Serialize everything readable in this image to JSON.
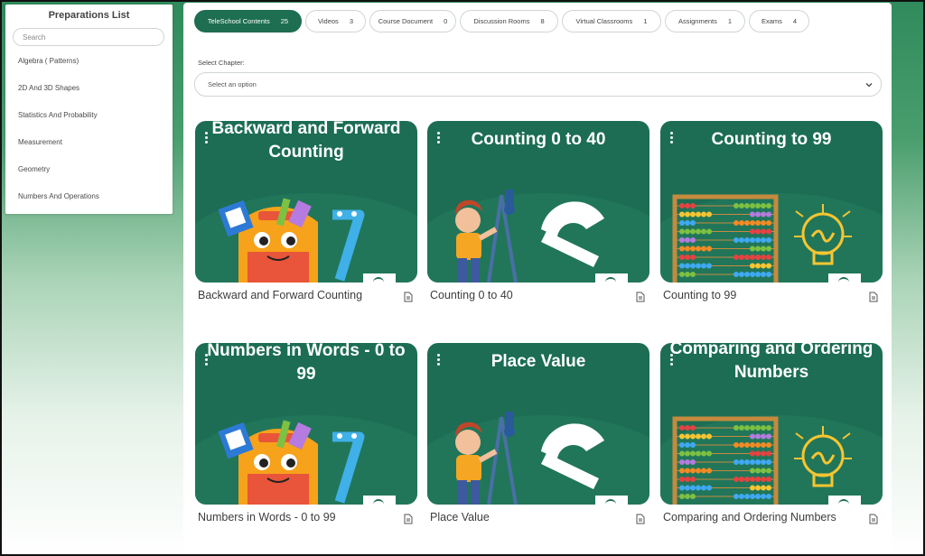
{
  "sidebar": {
    "title": "Preparations List",
    "search_placeholder": "Search",
    "items": [
      {
        "label": "Algebra ( Patterns)"
      },
      {
        "label": "2D And 3D Shapes"
      },
      {
        "label": "Statistics And Probability"
      },
      {
        "label": "Measurement"
      },
      {
        "label": "Geometry"
      },
      {
        "label": "Numbers And Operations"
      }
    ]
  },
  "tabs": [
    {
      "label": "TeleSchool Contents",
      "count": "25",
      "active": true
    },
    {
      "label": "Videos",
      "count": "3"
    },
    {
      "label": "Course Document",
      "count": "0"
    },
    {
      "label": "Discussion Rooms",
      "count": "8"
    },
    {
      "label": "Virtual Classrooms",
      "count": "1"
    },
    {
      "label": "Assignments",
      "count": "1"
    },
    {
      "label": "Exams",
      "count": "4"
    }
  ],
  "chapter": {
    "label": "Select Chapter:",
    "placeholder": "Select an option"
  },
  "cards": [
    {
      "thumb_title": "Backward and Forward Counting",
      "label": "Backward and Forward Counting",
      "art": "backpack",
      "icon": "document-icon"
    },
    {
      "thumb_title": "Counting 0 to 40",
      "label": "Counting 0 to 40",
      "art": "boy-compass",
      "icon": "document-icon"
    },
    {
      "thumb_title": "Counting to 99",
      "label": "Counting to 99",
      "art": "abacus",
      "icon": "document-icon"
    },
    {
      "thumb_title": "Numbers in Words - 0 to 99",
      "label": "Numbers in Words - 0 to 99",
      "art": "backpack",
      "icon": "document-icon"
    },
    {
      "thumb_title": "Place Value",
      "label": "Place Value",
      "art": "boy-compass",
      "icon": "document-icon"
    },
    {
      "thumb_title": "Comparing and Ordering Numbers",
      "label": "Comparing and Ordering Numbers",
      "art": "abacus",
      "icon": "document-icon"
    }
  ],
  "colors": {
    "brand": "#1e6e52",
    "card_bg": "#1c6d53",
    "accent_yellow": "#f7c531"
  }
}
